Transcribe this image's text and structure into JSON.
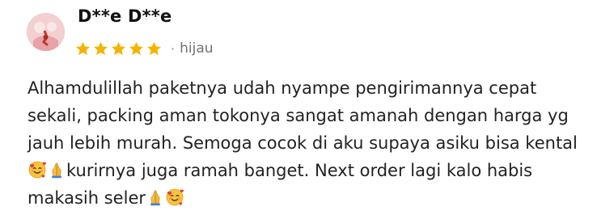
{
  "review": {
    "reviewer": {
      "name": "D**e D**e",
      "avatar_icon": "reviewer-avatar"
    },
    "rating": {
      "stars": 5,
      "max": 5,
      "star_color": "#f5b400"
    },
    "separator": "·",
    "variant": "hijau",
    "text": {
      "part1": "Alhamdulillah paketnya udah nyampe pengirimannya cepat sekali, packing aman tokonya sangat amanah dengan harga yg jauh lebih murah. Semoga cocok di aku supaya asiku bisa kental",
      "part2": "kurirnya juga ramah banget. Next order lagi kalo habis makasih seler"
    },
    "emoji": [
      "smiling-face-with-hearts",
      "folded-hands",
      "folded-hands",
      "smiling-face-with-hearts"
    ]
  }
}
